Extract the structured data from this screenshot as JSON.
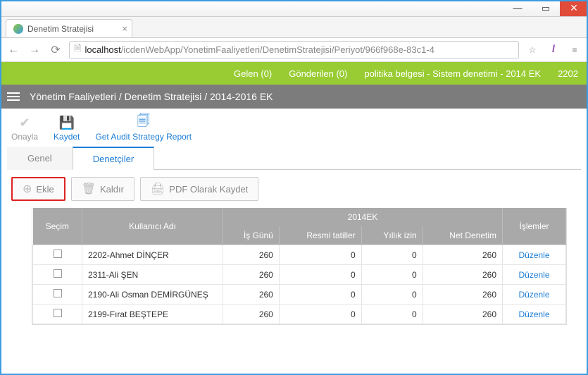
{
  "window": {
    "tab_title": "Denetim Stratejisi",
    "url_host": "localhost",
    "url_path": "/icdenWebApp/YonetimFaaliyetleri/DenetimStratejisi/Periyot/966f968e-83c1-4"
  },
  "greenbar": {
    "gelen": "Gelen (0)",
    "gonderilen": "Gönderilen (0)",
    "center": "politika belgesi - Sistem denetimi - 2014 EK",
    "right": "2202"
  },
  "breadcrumb": "Yönetim Faaliyetleri / Denetim Stratejisi / 2014-2016 EK",
  "toolbar": {
    "onayla": "Onayla",
    "kaydet": "Kaydet",
    "report": "Get Audit Strategy Report"
  },
  "tabs": {
    "genel": "Genel",
    "denetciler": "Denetçiler"
  },
  "actions": {
    "ekle": "Ekle",
    "kaldir": "Kaldır",
    "pdf": "PDF Olarak Kaydet"
  },
  "table": {
    "group_title": "2014EK",
    "headers": {
      "secim": "Seçim",
      "kullanici": "Kullanıcı Adı",
      "isgun": "İş Günü",
      "resmi": "Resmi tatiller",
      "yillik": "Yıllık izin",
      "net": "Net Denetim",
      "islemler": "İşlemler"
    },
    "action_label": "Düzenle",
    "rows": [
      {
        "user": "2202-Ahmet DİNÇER",
        "isgun": 260,
        "resmi": 0,
        "yillik": 0,
        "net": 260
      },
      {
        "user": "2311-Ali ŞEN",
        "isgun": 260,
        "resmi": 0,
        "yillik": 0,
        "net": 260
      },
      {
        "user": "2190-Ali Osman DEMİRGÜNEŞ",
        "isgun": 260,
        "resmi": 0,
        "yillik": 0,
        "net": 260
      },
      {
        "user": "2199-Fırat BEŞTEPE",
        "isgun": 260,
        "resmi": 0,
        "yillik": 0,
        "net": 260
      }
    ]
  }
}
